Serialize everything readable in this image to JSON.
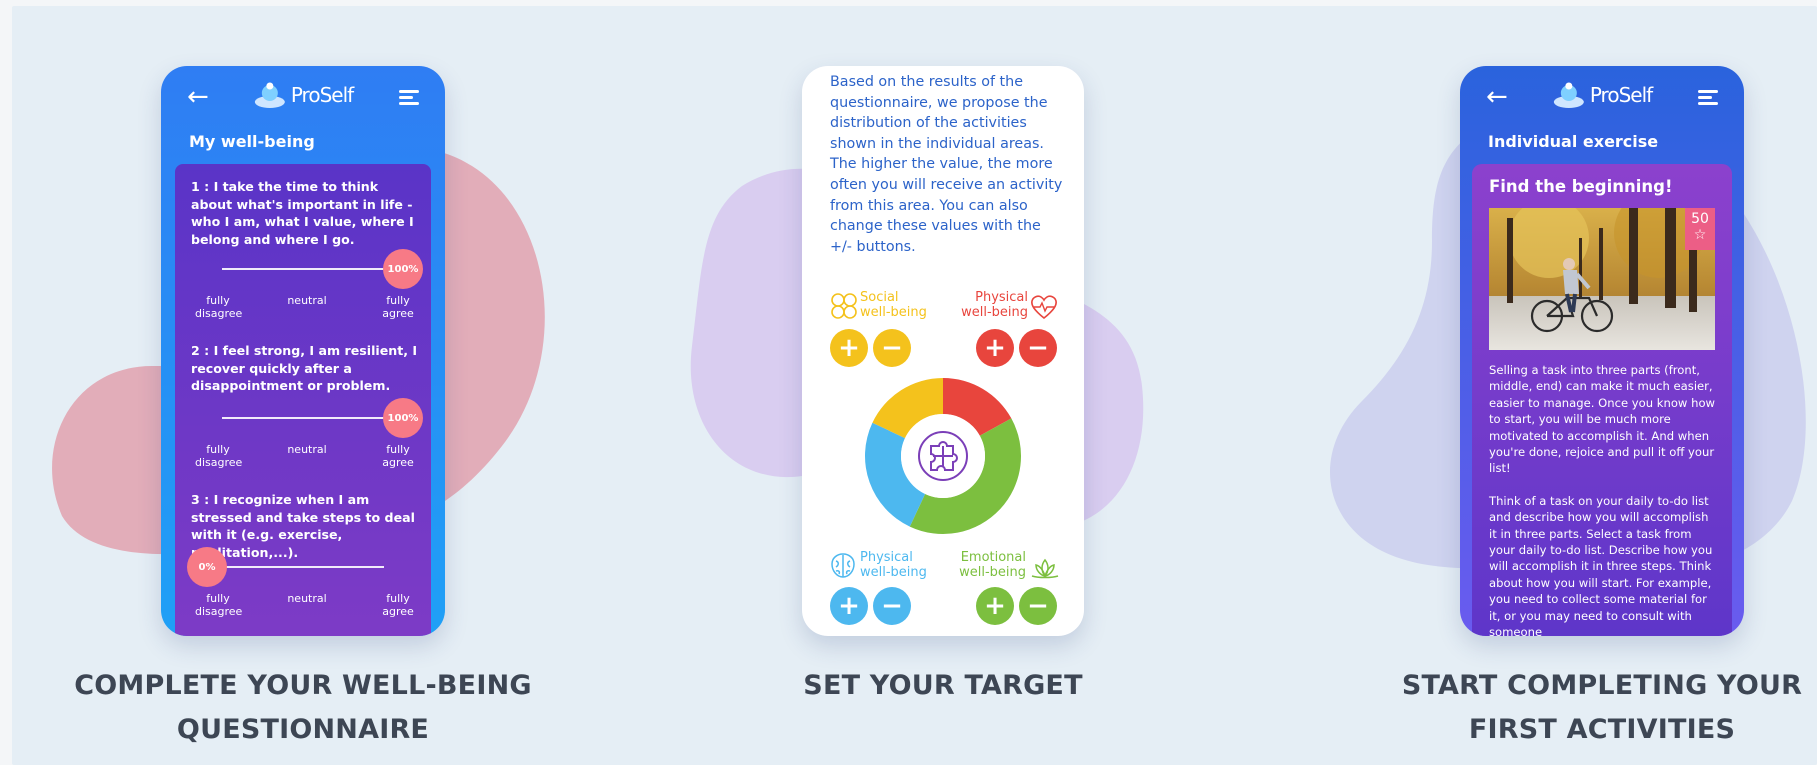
{
  "colors": {
    "page_bg": "#e5eef5",
    "caption": "#3d4654",
    "slider_knob": "#f77a86",
    "social": "#f4c21c",
    "physical_health": "#e8453d",
    "mental": "#4db8ef",
    "emotional": "#7cbf3f"
  },
  "app": {
    "logo_text": "ProSelf"
  },
  "step1": {
    "caption_line1": "COMPLETE YOUR WELL-BEING",
    "caption_line2": "QUESTIONNAIRE",
    "screen_title": "My well-being",
    "scale_left": "fully disagree",
    "scale_mid": "neutral",
    "scale_right": "fully agree",
    "questions": [
      {
        "text": "1 : I take the time to think about what's important in life - who I am, what I value, where I belong and where I go.",
        "value_label": "100%",
        "value": 1.0
      },
      {
        "text": "2 : I feel strong, I am resilient, I recover quickly after a disappointment or problem.",
        "value_label": "100%",
        "value": 1.0
      },
      {
        "text": "3 : I recognize when I am stressed and take steps to deal with it (e.g. exercise, meditation,...).",
        "value_label": "0%",
        "value": 0.0
      }
    ]
  },
  "step2": {
    "caption": "SET YOUR TARGET",
    "paragraph": "Based on the results of the questionnaire, we propose the distribution of the activities shown in the individual areas. The higher the value, the more often you will receive an activity from this area. You can also change these values with the +/- buttons.",
    "areas": {
      "social": {
        "line1": "Social",
        "line2": "well-being",
        "icon": "clover-icon"
      },
      "physical_top": {
        "line1": "Physical",
        "line2": "well-being",
        "icon": "heart-pulse-icon"
      },
      "physical_bottom": {
        "line1": "Physical",
        "line2": "well-being",
        "icon": "brain-icon"
      },
      "emotional": {
        "line1": "Emotional",
        "line2": "well-being",
        "icon": "lotus-icon"
      }
    },
    "plus": "+",
    "minus": "−",
    "distribution": [
      {
        "area": "Social",
        "value": 0.18
      },
      {
        "area": "Physical (heart)",
        "value": 0.17
      },
      {
        "area": "Emotional",
        "value": 0.4
      },
      {
        "area": "Physical (brain)",
        "value": 0.25
      }
    ]
  },
  "step3": {
    "caption_line1": "START COMPLETING YOUR",
    "caption_line2": "FIRST ACTIVITIES",
    "screen_title": "Individual exercise",
    "exercise_title": "Find the beginning!",
    "points": "50",
    "star": "☆",
    "paragraph1": "Selling a task into three parts (front, middle, end) can make it much easier, easier to manage. Once you know how to start, you will be much more motivated to accomplish it. And when you're done, rejoice and pull it off your list!",
    "paragraph2": "Think of a task on your daily to-do list and describe how you will accomplish it in three parts. Select a task from your daily to-do list. Describe how you will accomplish it in three steps. Think about how you will start. For example, you need to collect some material for it, or you may need to consult with someone"
  },
  "nav": {
    "back": "←"
  }
}
